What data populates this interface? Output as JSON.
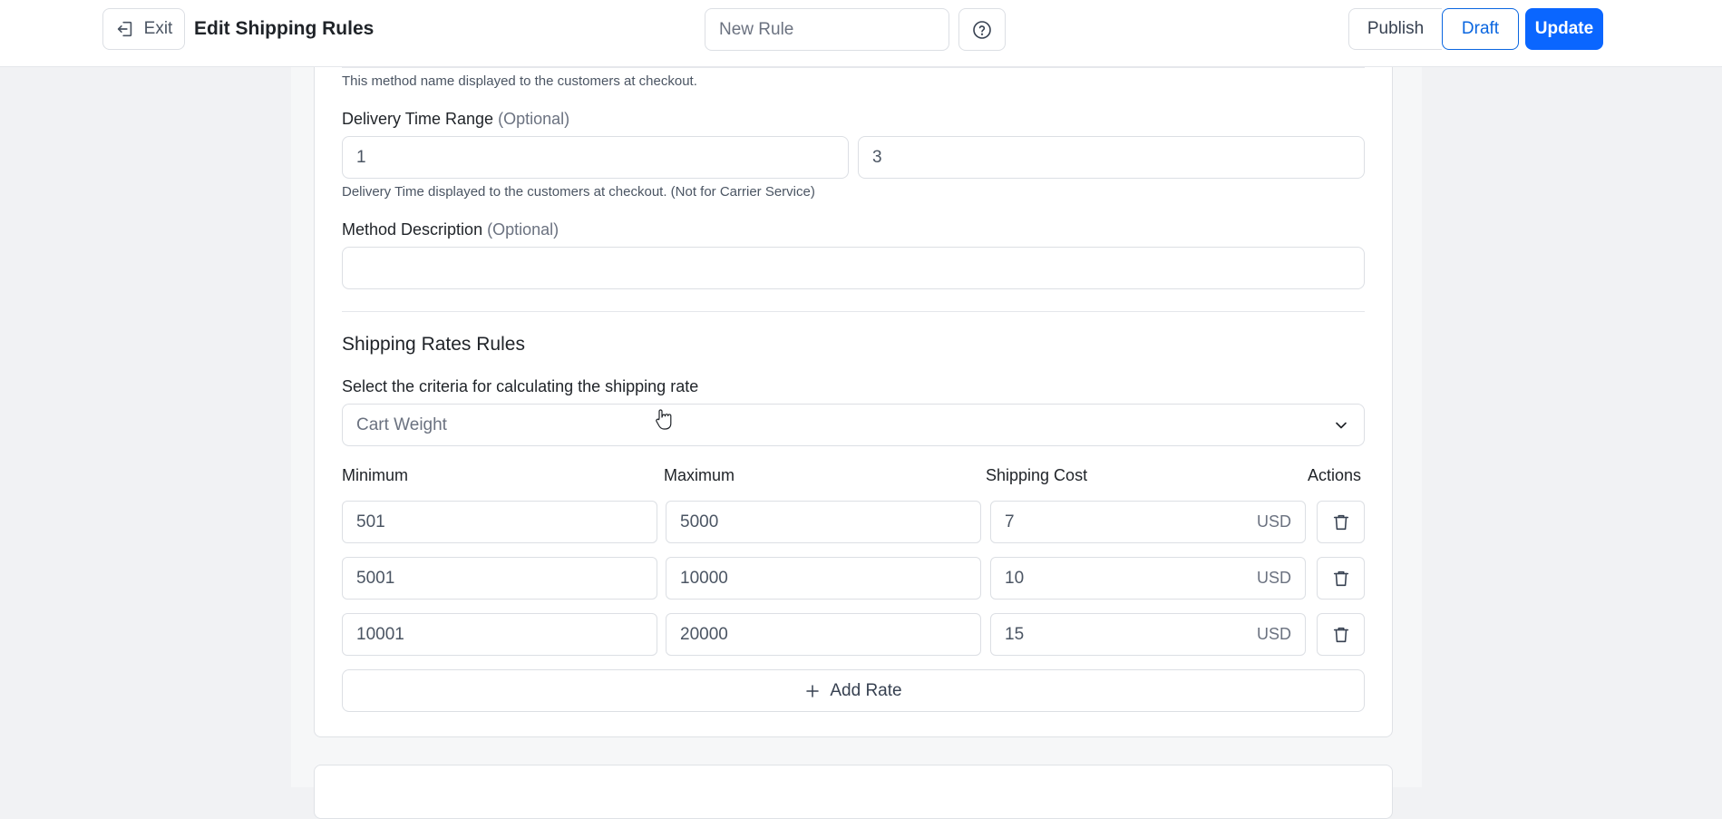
{
  "header": {
    "exit_label": "Exit",
    "title": "Edit Shipping Rules",
    "rule_name_value": "New Rule",
    "publish_label": "Publish",
    "draft_label": "Draft",
    "update_label": "Update"
  },
  "method": {
    "name_help": "This method name displayed to the customers at checkout.",
    "delivery_label": "Delivery Time Range",
    "optional_label": "(Optional)",
    "delivery_min": "1",
    "delivery_max": "3",
    "delivery_help": "Delivery Time displayed to the customers at checkout. (Not for Carrier Service)",
    "description_label": "Method Description",
    "description_value": ""
  },
  "rates": {
    "section_title": "Shipping Rates Rules",
    "criteria_label": "Select the criteria for calculating the shipping rate",
    "criteria_value": "Cart Weight",
    "columns": [
      "Minimum",
      "Maximum",
      "Shipping Cost",
      "Actions"
    ],
    "currency": "USD",
    "rows": [
      {
        "min": "501",
        "max": "5000",
        "cost": "7"
      },
      {
        "min": "5001",
        "max": "10000",
        "cost": "10"
      },
      {
        "min": "10001",
        "max": "20000",
        "cost": "15"
      }
    ],
    "add_rate_label": "Add Rate"
  },
  "colors": {
    "accent": "#0a66ff",
    "draft_border": "#0a66e0"
  }
}
